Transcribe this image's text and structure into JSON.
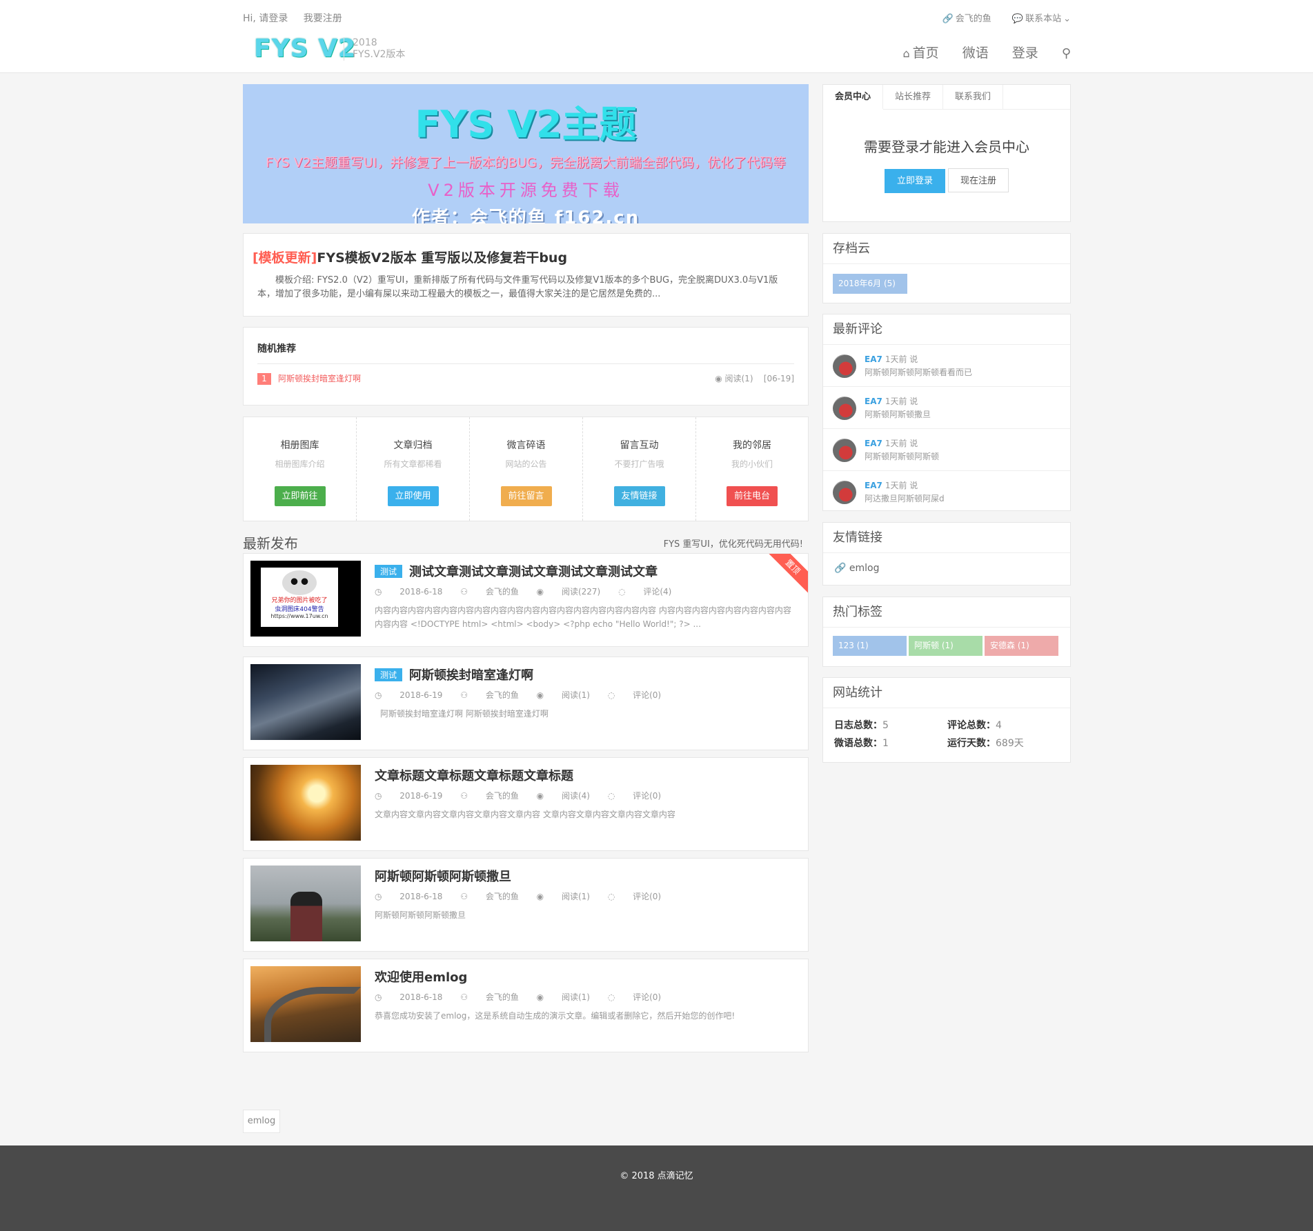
{
  "top": {
    "login_text": "Hi, 请登录",
    "register_text": "我要注册",
    "author_link": "会飞的鱼",
    "contact_link": "联系本站"
  },
  "logo": {
    "name": "FYS V2",
    "year": "2018",
    "version": "FYS.V2版本"
  },
  "nav": {
    "home": "首页",
    "weiyu": "微语",
    "login": "登录"
  },
  "banner": {
    "line1": "FYS V2主题",
    "line2": "FYS V2主题重写UI，并修复了上一版本的BUG，完全脱离大前端全部代码，优化了代码等",
    "line3": "V2版本开源免费下载",
    "line4": "作者：会飞的鱼 f162.cn"
  },
  "sticky": {
    "tag": "[模板更新]",
    "title": "FYS模板V2版本 重写版以及修复若干bug",
    "desc": "模板介绍: FYS2.0（V2）重写UI，重新排版了所有代码与文件重写代码以及修复V1版本的多个BUG，完全脱离DUX3.0与V1版本，增加了很多功能，是小编有屎以来动工程最大的模板之一，最值得大家关注的是它居然是免费的..."
  },
  "random": {
    "heading": "随机推荐",
    "item": {
      "num": "1",
      "title": "阿斯顿挨封暗室逢灯啊",
      "reads": "阅读(1)",
      "date": "[06-19]"
    }
  },
  "quick_links": [
    {
      "title": "相册图库",
      "desc": "相册图库介绍",
      "button": "立即前往",
      "color": "#4cae4c"
    },
    {
      "title": "文章归档",
      "desc": "所有文章都稀看",
      "button": "立即使用",
      "color": "#3ab0ec"
    },
    {
      "title": "微言碎语",
      "desc": "网站的公告",
      "button": "前往留言",
      "color": "#f0ad4e"
    },
    {
      "title": "留言互动",
      "desc": "不要打广告哦",
      "button": "友情链接",
      "color": "#40b0e0"
    },
    {
      "title": "我的邻居",
      "desc": "我的小伙们",
      "button": "前往电台",
      "color": "#f05050"
    }
  ],
  "latest": {
    "heading": "最新发布",
    "slogan": "FYS 重写UI，优化死代码无用代码!"
  },
  "posts": [
    {
      "category": "测试",
      "title": "测试文章测试文章测试文章测试文章测试文章",
      "date": "2018-6-18",
      "author": "会飞的鱼",
      "reads": "阅读(227)",
      "comments": "评论(4)",
      "desc": "内容内容内容内容内容内容内容内容内容内容内容内容内容内容内容内容内容 内容内容内容内容内容内容内容内容内容内容 <!DOCTYPE html> <html> <body> <?php echo \"Hello World!\"; ?> ...",
      "ribbon": "置顶",
      "thumb_line1": "兄弟你的图片被吃了",
      "thumb_line2": "虫洞图床404警告",
      "thumb_line3": "https://www.17uw.cn"
    },
    {
      "category": "测试",
      "title": "阿斯顿挨封暗室逢灯啊",
      "date": "2018-6-19",
      "author": "会飞的鱼",
      "reads": "阅读(1)",
      "comments": "评论(0)",
      "desc": "阿斯顿挨封暗室逢灯啊    阿斯顿挨封暗室逢灯啊"
    },
    {
      "category": "",
      "title": "文章标题文章标题文章标题文章标题",
      "date": "2018-6-19",
      "author": "会飞的鱼",
      "reads": "阅读(4)",
      "comments": "评论(0)",
      "desc": "文章内容文章内容文章内容文章内容文章内容 文章内容文章内容文章内容文章内容"
    },
    {
      "category": "",
      "title": "阿斯顿阿斯顿阿斯顿撒旦",
      "date": "2018-6-18",
      "author": "会飞的鱼",
      "reads": "阅读(1)",
      "comments": "评论(0)",
      "desc": "阿斯顿阿斯顿阿斯顿撒旦"
    },
    {
      "category": "",
      "title": "欢迎使用emlog",
      "date": "2018-6-18",
      "author": "会飞的鱼",
      "reads": "阅读(1)",
      "comments": "评论(0)",
      "desc": "恭喜您成功安装了emlog，这是系统自动生成的演示文章。编辑或者删除它，然后开始您的创作吧!"
    }
  ],
  "pagination": {
    "label": "emlog"
  },
  "footer": {
    "copyright": "© 2018 点滴记忆"
  },
  "sidebar": {
    "tabs": [
      "会员中心",
      "站长推荐",
      "联系我们"
    ],
    "member_msg": "需要登录才能进入会员中心",
    "login_btn": "立即登录",
    "register_btn": "现在注册",
    "archive": {
      "heading": "存档云",
      "item": "2018年6月 (5)"
    },
    "comments": {
      "heading": "最新评论",
      "items": [
        {
          "user": "EA7",
          "time": "1天前 说",
          "text": "阿斯顿阿斯顿阿斯顿看看而已"
        },
        {
          "user": "EA7",
          "time": "1天前 说",
          "text": "阿斯顿阿斯顿撒旦"
        },
        {
          "user": "EA7",
          "time": "1天前 说",
          "text": "阿斯顿阿斯顿阿斯顿"
        },
        {
          "user": "EA7",
          "time": "1天前 说",
          "text": "阿达撒旦阿斯顿阿屎d"
        }
      ]
    },
    "links": {
      "heading": "友情链接",
      "item": "emlog"
    },
    "tags": {
      "heading": "热门标签",
      "items": [
        "123 (1)",
        "阿斯顿 (1)",
        "安德森 (1)"
      ],
      "colors": [
        "#a1c3ea",
        "#a8dca8",
        "#eeaaaa"
      ]
    },
    "stats": {
      "heading": "网站统计",
      "posts_label": "日志总数：",
      "posts": "5",
      "comments_label": "评论总数：",
      "comments": "4",
      "weiyu_label": "微语总数：",
      "weiyu": "1",
      "days_label": "运行天数：",
      "days": "689天"
    }
  }
}
